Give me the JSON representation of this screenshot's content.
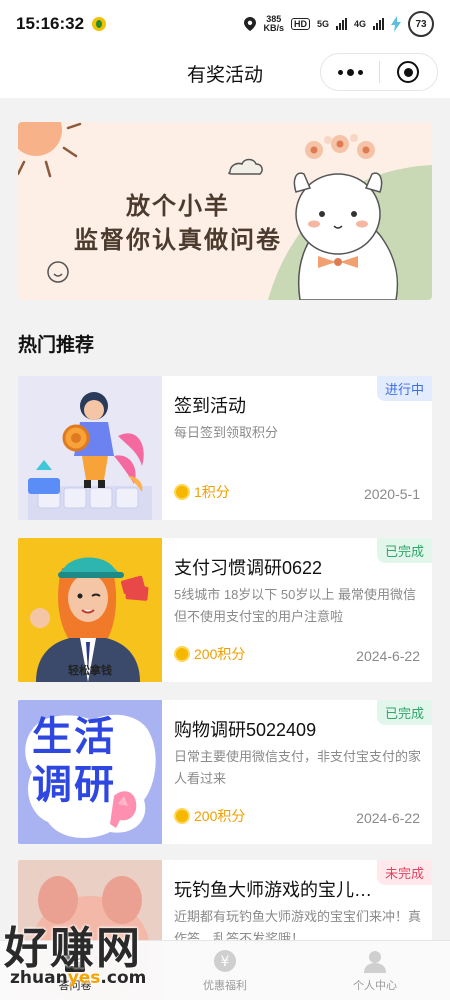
{
  "status_bar": {
    "time": "15:16:32",
    "speed_value": "385",
    "speed_unit": "KB/s",
    "hd_label": "HD",
    "net_1": "5G",
    "net_2": "4G",
    "battery": "73"
  },
  "header": {
    "title": "有奖活动"
  },
  "banner": {
    "line1": "放个小羊",
    "line2": "监督你认真做问卷"
  },
  "section": {
    "title": "热门推荐"
  },
  "cards": [
    {
      "title": "签到活动",
      "desc": "每日签到领取积分",
      "points": "1积分",
      "date": "2020-5-1",
      "status": "进行中"
    },
    {
      "title": "支付习惯调研0622",
      "desc": "5线城市 18岁以下 50岁以上 最常使用微信 但不使用支付宝的用户注意啦",
      "points": "200积分",
      "date": "2024-6-22",
      "status": "已完成",
      "img_caption": "轻松拿钱"
    },
    {
      "title": "购物调研5022409",
      "desc": "日常主要使用微信支付，非支付宝支付的家人看过来",
      "points": "200积分",
      "date": "2024-6-22",
      "status": "已完成",
      "img_text_1": "生活",
      "img_text_2": "调研"
    },
    {
      "title": "玩钓鱼大师游戏的宝儿…",
      "desc": "近期都有玩钓鱼大师游戏的宝宝们来冲！真作答，乱答不发奖哦！",
      "status": "未完成"
    }
  ],
  "tabbar": [
    {
      "label": "答问卷",
      "icon": "questionnaire-icon",
      "active": true
    },
    {
      "label": "优惠福利",
      "icon": "coupon-yen-icon",
      "active": false
    },
    {
      "label": "个人中心",
      "icon": "user-icon",
      "active": false
    }
  ],
  "watermark": {
    "big": "好赚网",
    "small_pre": "zhuan",
    "small_mid": "yes",
    "small_post": ".com"
  },
  "colors": {
    "badge_progress": "#3d6fe0",
    "badge_done": "#2fa66a",
    "badge_undone": "#e04560",
    "points": "#f0a000"
  }
}
